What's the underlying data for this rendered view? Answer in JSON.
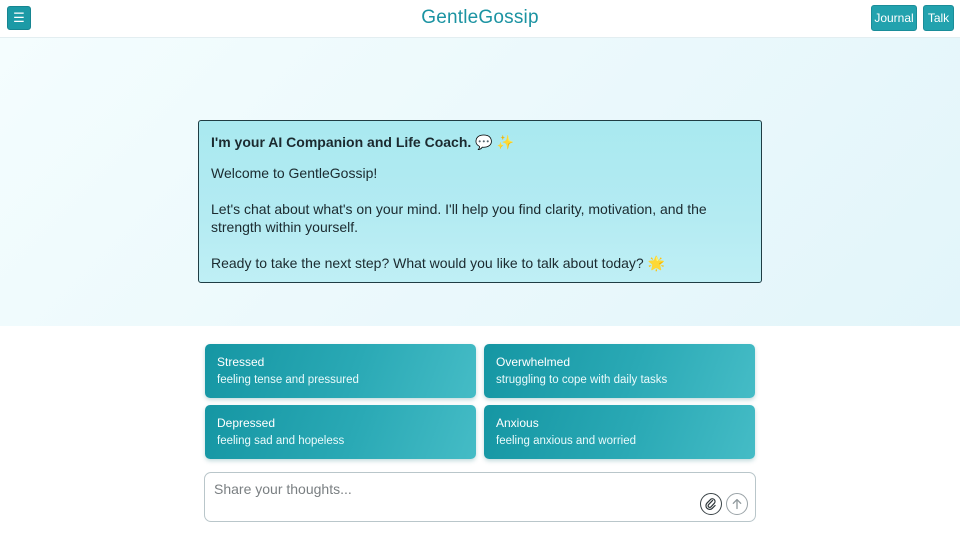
{
  "header": {
    "brand": "GentleGossip",
    "menu_icon": "☰",
    "nav": [
      {
        "label": "Journal"
      },
      {
        "label": "Talk"
      }
    ]
  },
  "welcome": {
    "title": "I'm your AI Companion and Life Coach.",
    "title_emojis": [
      "💬",
      "✨"
    ],
    "lines": [
      "Welcome to GentleGossip!",
      "Let's chat about what's on your mind. I'll help you find clarity, motivation, and the strength within yourself.",
      "Ready to take the next step? What would you like to talk about today?"
    ],
    "closing_emoji": "🌟"
  },
  "moods": [
    {
      "title": "Stressed",
      "desc": "feeling tense and pressured"
    },
    {
      "title": "Overwhelmed",
      "desc": "struggling to cope with daily tasks"
    },
    {
      "title": "Depressed",
      "desc": "feeling sad and hopeless"
    },
    {
      "title": "Anxious",
      "desc": "feeling anxious and worried"
    }
  ],
  "input": {
    "placeholder": "Share your thoughts...",
    "value": ""
  },
  "icons": {
    "attach": "paperclip-icon",
    "send": "arrow-up-icon",
    "menu": "hamburger-icon"
  },
  "colors": {
    "brand": "#1b93a2",
    "accent": "#22a2ae",
    "card_bg": "#b4ebf2"
  }
}
